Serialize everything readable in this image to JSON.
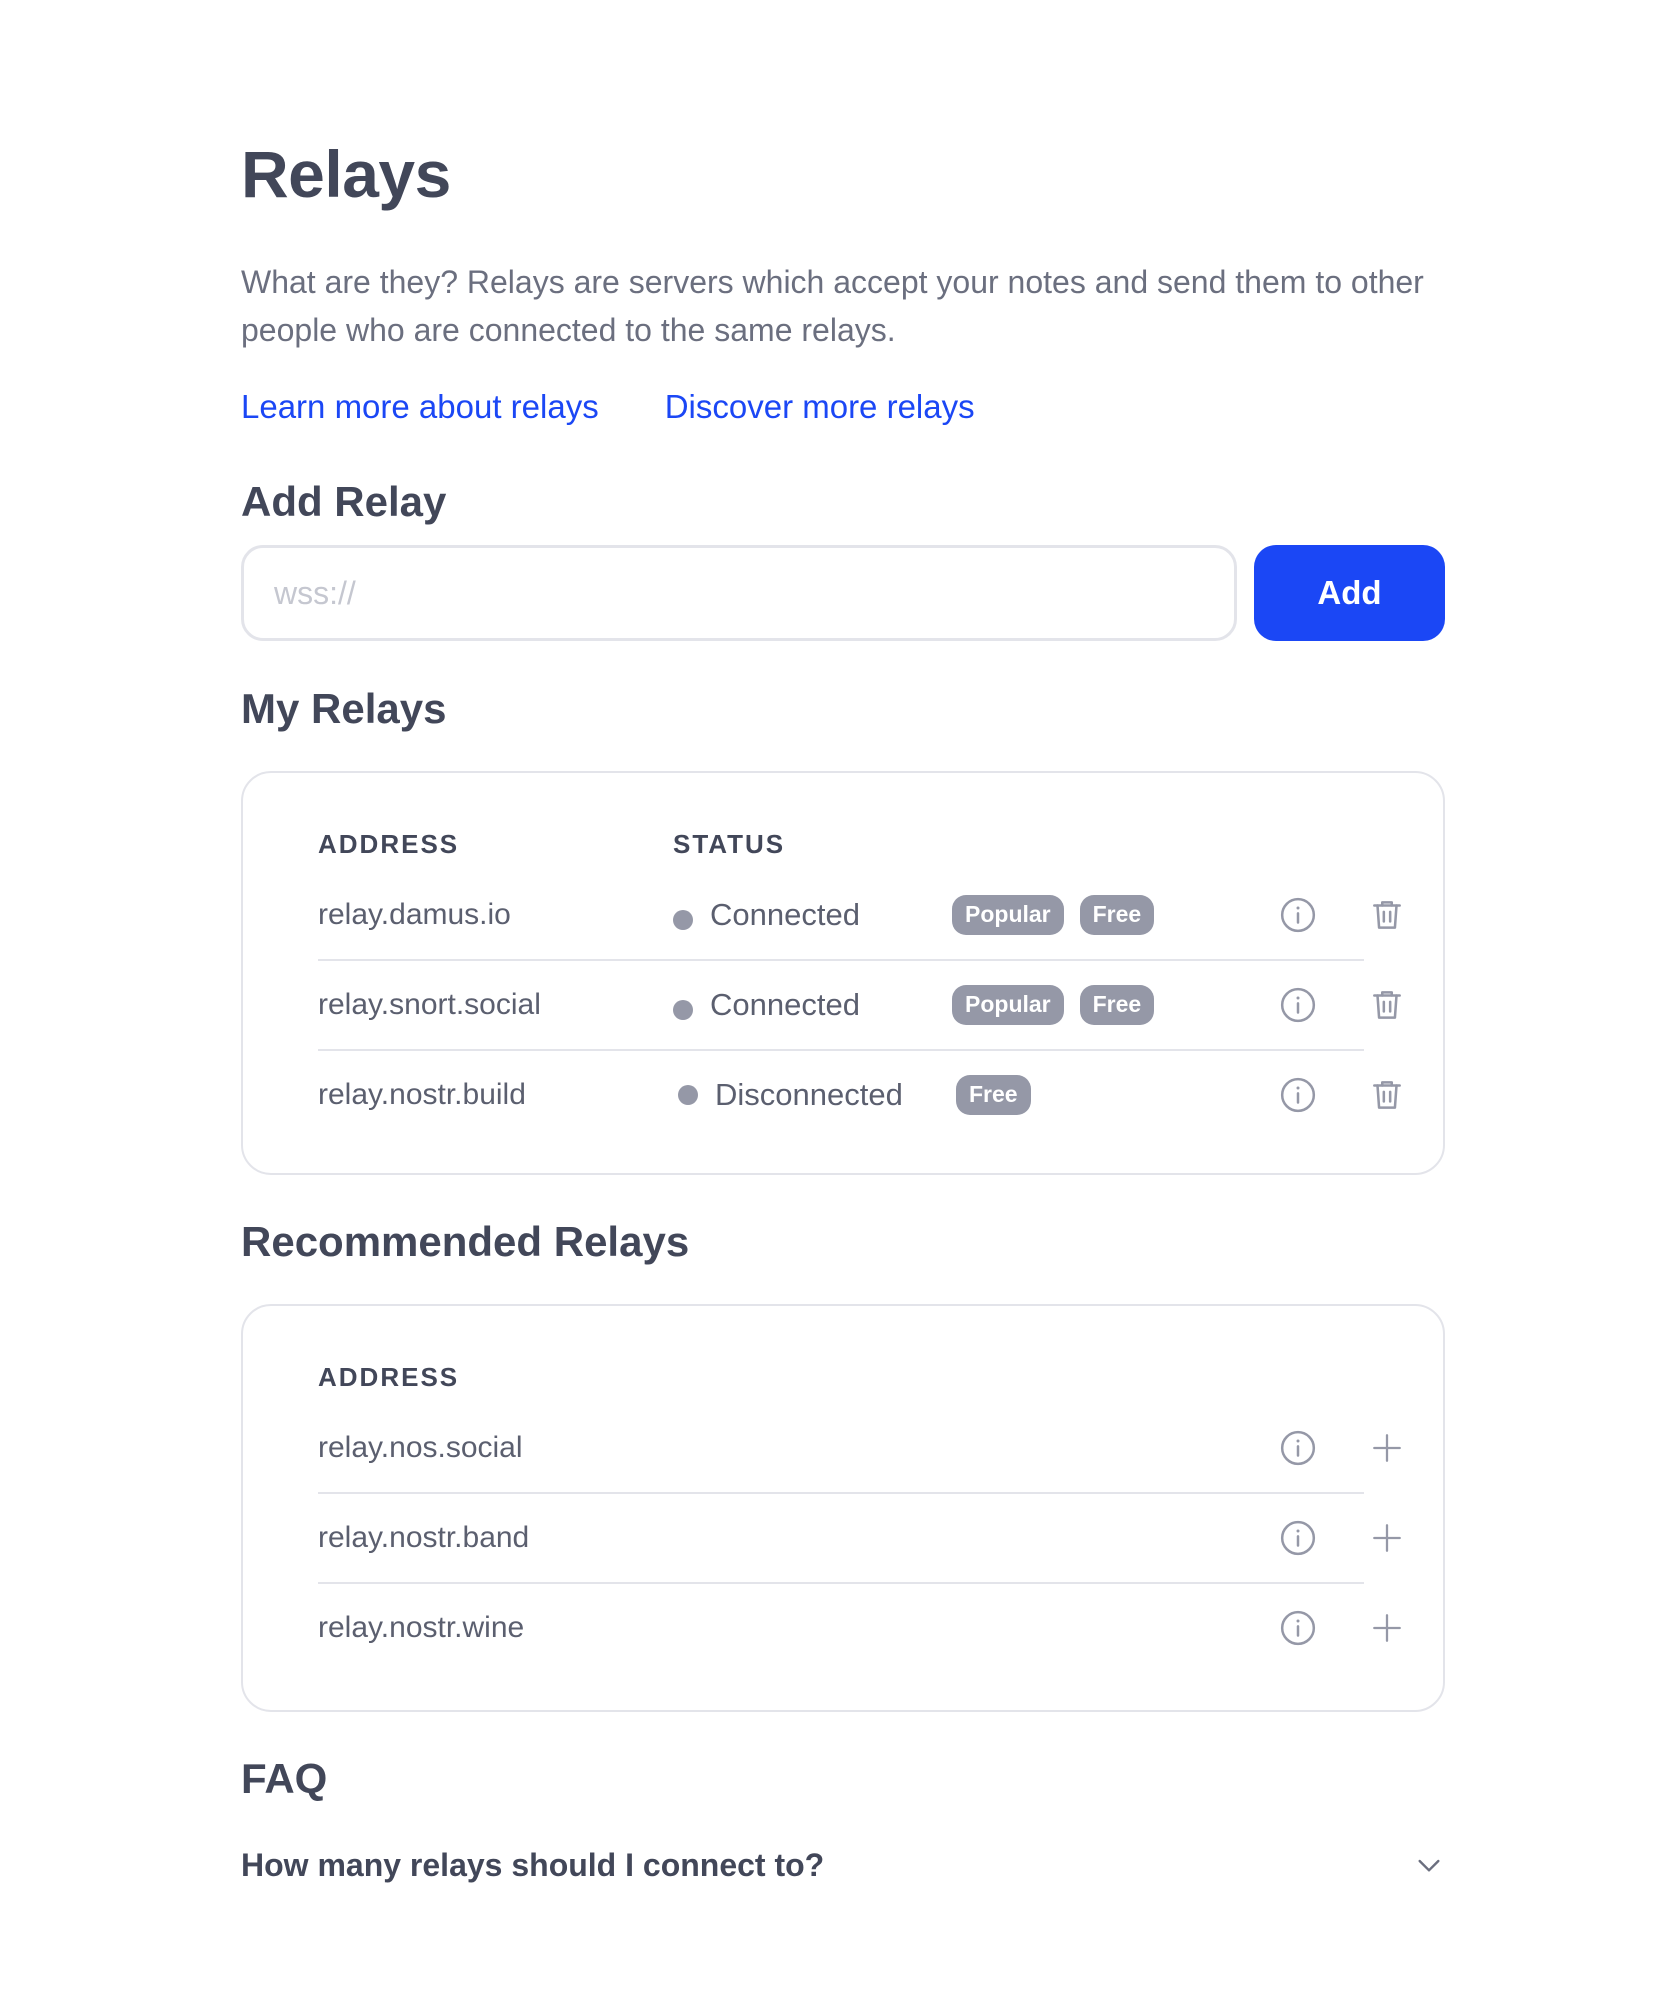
{
  "page": {
    "title": "Relays",
    "description": "What are they? Relays are servers which accept your notes and send them to other people who are connected to the same relays.",
    "links": {
      "learn_more": "Learn more about relays",
      "discover": "Discover more relays"
    }
  },
  "add_relay": {
    "heading": "Add Relay",
    "placeholder": "wss://",
    "button_label": "Add"
  },
  "my_relays": {
    "heading": "My Relays",
    "columns": {
      "address": "ADDRESS",
      "status": "STATUS"
    },
    "rows": [
      {
        "address": "relay.damus.io",
        "status": "Connected",
        "badges": [
          "Popular",
          "Free"
        ]
      },
      {
        "address": "relay.snort.social",
        "status": "Connected",
        "badges": [
          "Popular",
          "Free"
        ]
      },
      {
        "address": "relay.nostr.build",
        "status": "Disconnected",
        "badges": [
          "Free"
        ]
      }
    ]
  },
  "recommended_relays": {
    "heading": "Recommended Relays",
    "columns": {
      "address": "ADDRESS"
    },
    "rows": [
      {
        "address": "relay.nos.social"
      },
      {
        "address": "relay.nostr.band"
      },
      {
        "address": "relay.nostr.wine"
      }
    ]
  },
  "faq": {
    "heading": "FAQ",
    "items": [
      {
        "question": "How many relays should I connect to?"
      }
    ]
  },
  "colors": {
    "accent": "#1b47f5",
    "badge": "#9598a7",
    "border": "#e3e4ea",
    "heading": "#424759"
  },
  "icons": {
    "info": "info-circle-icon",
    "delete": "trash-icon",
    "add": "plus-icon",
    "expand": "chevron-down-icon"
  }
}
